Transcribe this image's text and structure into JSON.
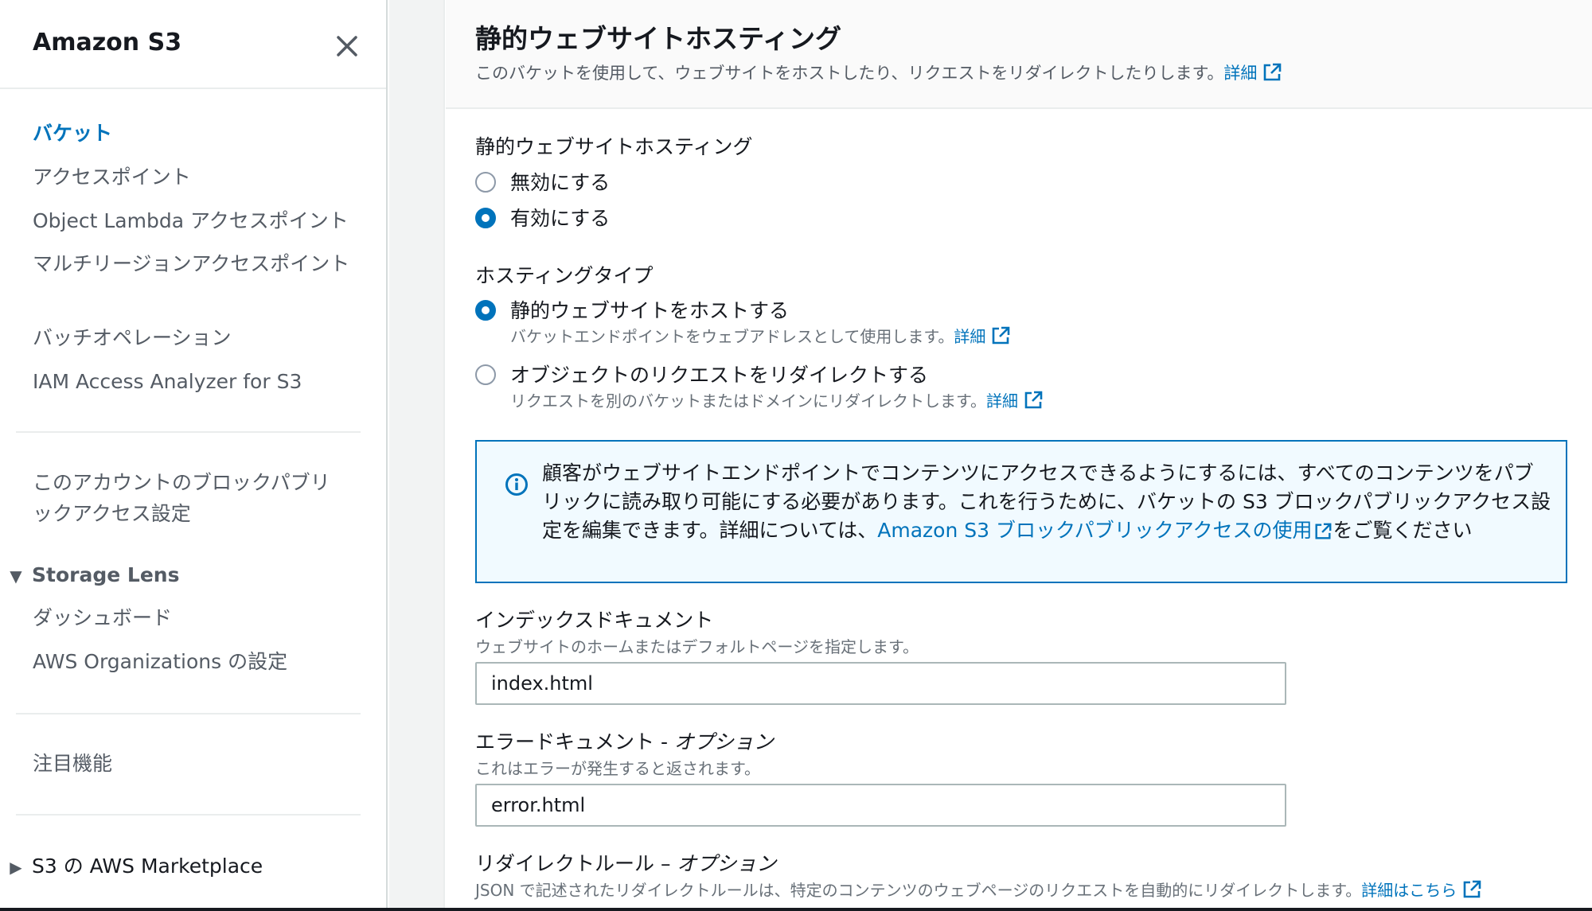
{
  "sidebar": {
    "title": "Amazon S3",
    "items": [
      {
        "label": "バケット",
        "active": true
      },
      {
        "label": "アクセスポイント"
      },
      {
        "label": "Object Lambda アクセスポイント"
      },
      {
        "label": "マルチリージョンアクセスポイント"
      },
      {
        "label": "バッチオペレーション"
      },
      {
        "label": "IAM Access Analyzer for S3"
      }
    ],
    "block_public_access": "このアカウントのブロックパブリックアクセス設定",
    "storage_lens": {
      "label": "Storage Lens",
      "items": [
        {
          "label": "ダッシュボード"
        },
        {
          "label": "AWS Organizations の設定"
        }
      ]
    },
    "featured": "注目機能",
    "marketplace": "S3 の AWS Marketplace"
  },
  "panel": {
    "title": "静的ウェブサイトホスティング",
    "description": "このバケットを使用して、ウェブサイトをホストしたり、リクエストをリダイレクトしたりします。",
    "detail_link": "詳細"
  },
  "hosting": {
    "label": "静的ウェブサイトホスティング",
    "options": [
      {
        "label": "無効にする",
        "selected": false
      },
      {
        "label": "有効にする",
        "selected": true
      }
    ]
  },
  "hosting_type": {
    "label": "ホスティングタイプ",
    "options": [
      {
        "label": "静的ウェブサイトをホストする",
        "description": "バケットエンドポイントをウェブアドレスとして使用します。",
        "link": "詳細",
        "selected": true
      },
      {
        "label": "オブジェクトのリクエストをリダイレクトする",
        "description": "リクエストを別のバケットまたはドメインにリダイレクトします。",
        "link": "詳細",
        "selected": false
      }
    ]
  },
  "info_box": {
    "text_before": "顧客がウェブサイトエンドポイントでコンテンツにアクセスできるようにするには、すべてのコンテンツをパブリックに読み取り可能にする必要があります。これを行うために、バケットの S3 ブロックパブリックアクセス設定を編集できます。詳細については、",
    "link": "Amazon S3 ブロックパブリックアクセスの使用",
    "text_after": "をご覧ください"
  },
  "index_document": {
    "label": "インデックスドキュメント",
    "description": "ウェブサイトのホームまたはデフォルトページを指定します。",
    "value": "index.html"
  },
  "error_document": {
    "label": "エラードキュメント - ",
    "optional": "オプション",
    "description": "これはエラーが発生すると返されます。",
    "value": "error.html"
  },
  "redirect_rules": {
    "label": "リダイレクトルール – ",
    "optional": "オプション",
    "description": "JSON で記述されたリダイレクトルールは、特定のコンテンツのウェブページのリクエストを自動的にリダイレクトします。",
    "link": "詳細はこちら"
  },
  "colors": {
    "accent": "#0073bb",
    "info_bg": "#f1faff",
    "text": "#16191f",
    "muted": "#687078"
  }
}
